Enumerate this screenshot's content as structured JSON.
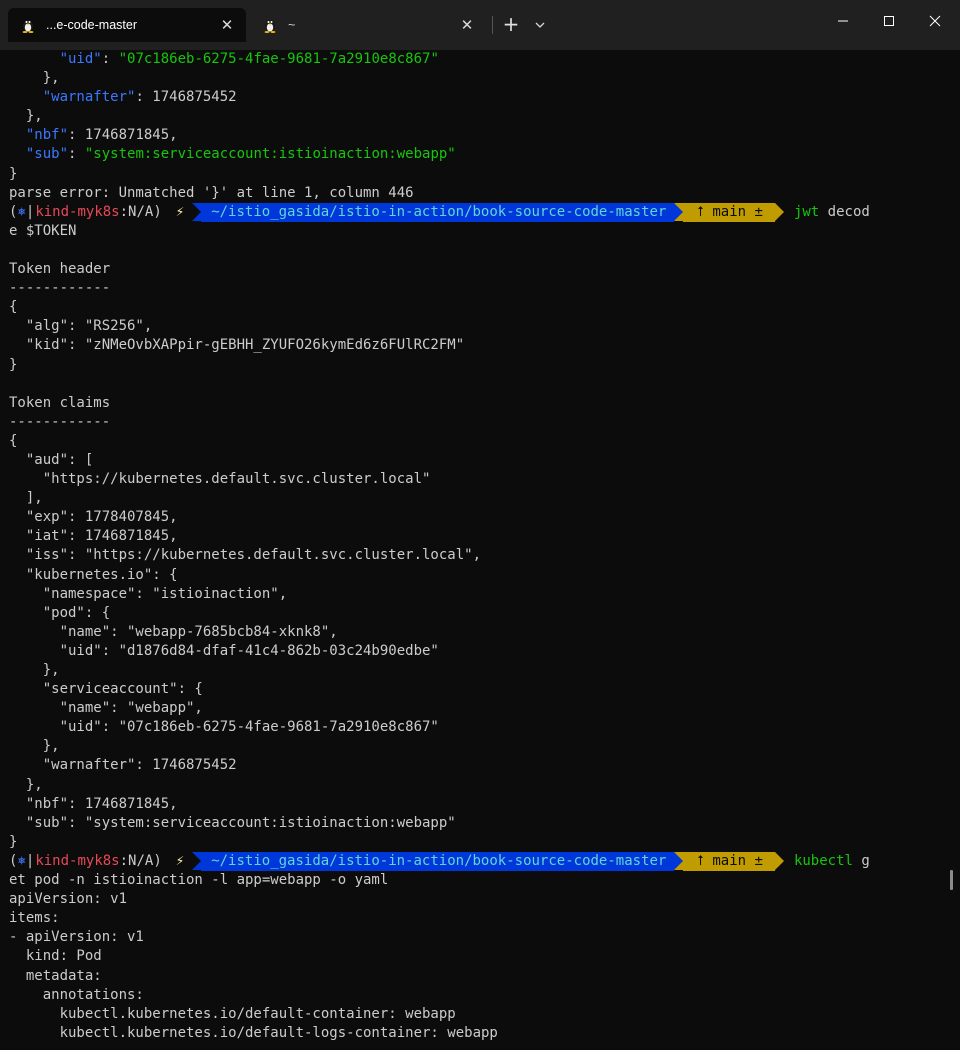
{
  "tabs": [
    {
      "label": "...e-code-master",
      "icon": "linux-tux-icon",
      "active": true
    },
    {
      "label": "~",
      "icon": "linux-tux-icon",
      "active": false
    }
  ],
  "window_controls": [
    "minimize",
    "maximize",
    "close"
  ],
  "colors": {
    "key": "#3b78ff",
    "string": "#16c60c",
    "path_bg": "#0037da",
    "git_bg": "#c19c00",
    "host": "#e74856"
  },
  "prompt": {
    "context": "kind-myk8s",
    "namespace": ":N/A",
    "path": "~/istio_gasida/istio-in-action/book-source-code-master",
    "branch": "⭡ main ±"
  },
  "cmd1": {
    "command": "jwt",
    "args": " decod",
    "wrap": "e $TOKEN"
  },
  "cmd2": {
    "command": "kubectl",
    "args": " g",
    "wrap": "et pod -n istioinaction -l app=webapp -o yaml"
  },
  "top": {
    "uid_key": "\"uid\"",
    "uid_val": "\"07c186eb-6275-4fae-9681-7a2910e8c867\"",
    "brace_close_comma": "},",
    "warnafter_key": "\"warnafter\"",
    "warnafter_val": ": 1746875452",
    "nbf_key": "\"nbf\"",
    "nbf_val": ": 1746871845,",
    "sub_key": "\"sub\"",
    "sub_val": "\"system:serviceaccount:istioinaction:webapp\"",
    "brace": "}",
    "parse_error": "parse error: Unmatched '}' at line 1, column 446"
  },
  "decoded": [
    "",
    "Token header",
    "------------",
    "{",
    "  \"alg\": \"RS256\",",
    "  \"kid\": \"zNMeOvbXAPpir-gEBHH_ZYUFO26kymEd6z6FUlRC2FM\"",
    "}",
    "",
    "Token claims",
    "------------",
    "{",
    "  \"aud\": [",
    "    \"https://kubernetes.default.svc.cluster.local\"",
    "  ],",
    "  \"exp\": 1778407845,",
    "  \"iat\": 1746871845,",
    "  \"iss\": \"https://kubernetes.default.svc.cluster.local\",",
    "  \"kubernetes.io\": {",
    "    \"namespace\": \"istioinaction\",",
    "    \"pod\": {",
    "      \"name\": \"webapp-7685bcb84-xknk8\",",
    "      \"uid\": \"d1876d84-dfaf-41c4-862b-03c24b90edbe\"",
    "    },",
    "    \"serviceaccount\": {",
    "      \"name\": \"webapp\",",
    "      \"uid\": \"07c186eb-6275-4fae-9681-7a2910e8c867\"",
    "    },",
    "    \"warnafter\": 1746875452",
    "  },",
    "  \"nbf\": 1746871845,",
    "  \"sub\": \"system:serviceaccount:istioinaction:webapp\"",
    "}"
  ],
  "yaml": [
    "apiVersion: v1",
    "items:",
    "- apiVersion: v1",
    "  kind: Pod",
    "  metadata:",
    "    annotations:",
    "      kubectl.kubernetes.io/default-container: webapp",
    "      kubectl.kubernetes.io/default-logs-container: webapp"
  ]
}
